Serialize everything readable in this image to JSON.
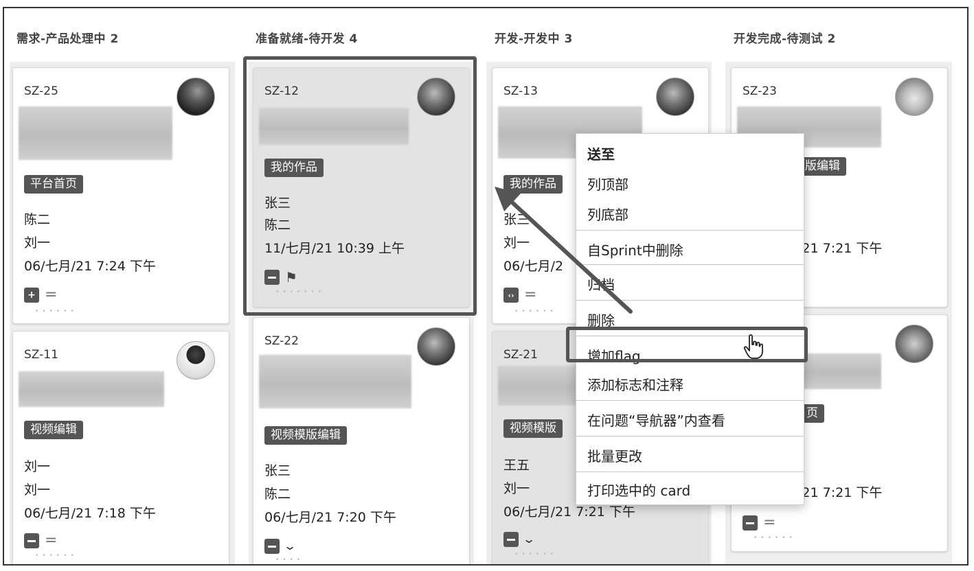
{
  "columns": [
    {
      "title": "需求-产品处理中 2"
    },
    {
      "title": "准备就绪-待开发 4"
    },
    {
      "title": "开发-开发中 3"
    },
    {
      "title": "开发完成-待测试 2"
    }
  ],
  "cards": {
    "sz25": {
      "key": "SZ-25",
      "tag": "平台首页",
      "assignee": "陈二",
      "reporter": "刘一",
      "date": "06/七月/21 7:24 下午",
      "icon": "plus-square-icon"
    },
    "sz11": {
      "key": "SZ-11",
      "tag": "视频编辑",
      "assignee": "刘一",
      "reporter": "刘一",
      "date": "06/七月/21 7:18 下午",
      "icon": "minus-square-icon"
    },
    "sz12": {
      "key": "SZ-12",
      "tag": "我的作品",
      "assignee": "张三",
      "reporter": "陈二",
      "date": "11/七月/21 10:39 上午",
      "icon": "minus-square-icon"
    },
    "sz22": {
      "key": "SZ-22",
      "tag": "视频模版编辑",
      "assignee": "张三",
      "reporter": "陈二",
      "date": "06/七月/21 7:20 下午",
      "icon": "minus-square-icon"
    },
    "sz13": {
      "key": "SZ-13",
      "tag": "我的作品",
      "assignee": "张三",
      "reporter": "刘一",
      "date": "06/七月/2",
      "icon": "code-square-icon"
    },
    "sz21": {
      "key": "SZ-21",
      "tag": "视频模版",
      "assignee": "王五",
      "reporter": "刘一",
      "date": "06/七月/21 7:21 下午",
      "icon": "minus-square-icon"
    },
    "sz23": {
      "key": "SZ-23",
      "tag": "版编辑",
      "date": "/21 7:21 下午"
    },
    "c4b": {
      "tag": "页",
      "date": "/21 7:21 下午",
      "icon": "minus-square-icon"
    }
  },
  "context_menu": {
    "header": "送至",
    "items": [
      "列顶部",
      "列底部",
      "自Sprint中删除",
      "归档",
      "删除",
      "增加flag",
      "添加标志和注释",
      "在问题“导航器”内查看",
      "批量更改",
      "打印选中的 card"
    ],
    "highlighted_item": "增加flag"
  },
  "colors": {
    "tag_bg": "#555555",
    "lane_bg": "#eeeeee",
    "highlight_border": "#555555"
  }
}
